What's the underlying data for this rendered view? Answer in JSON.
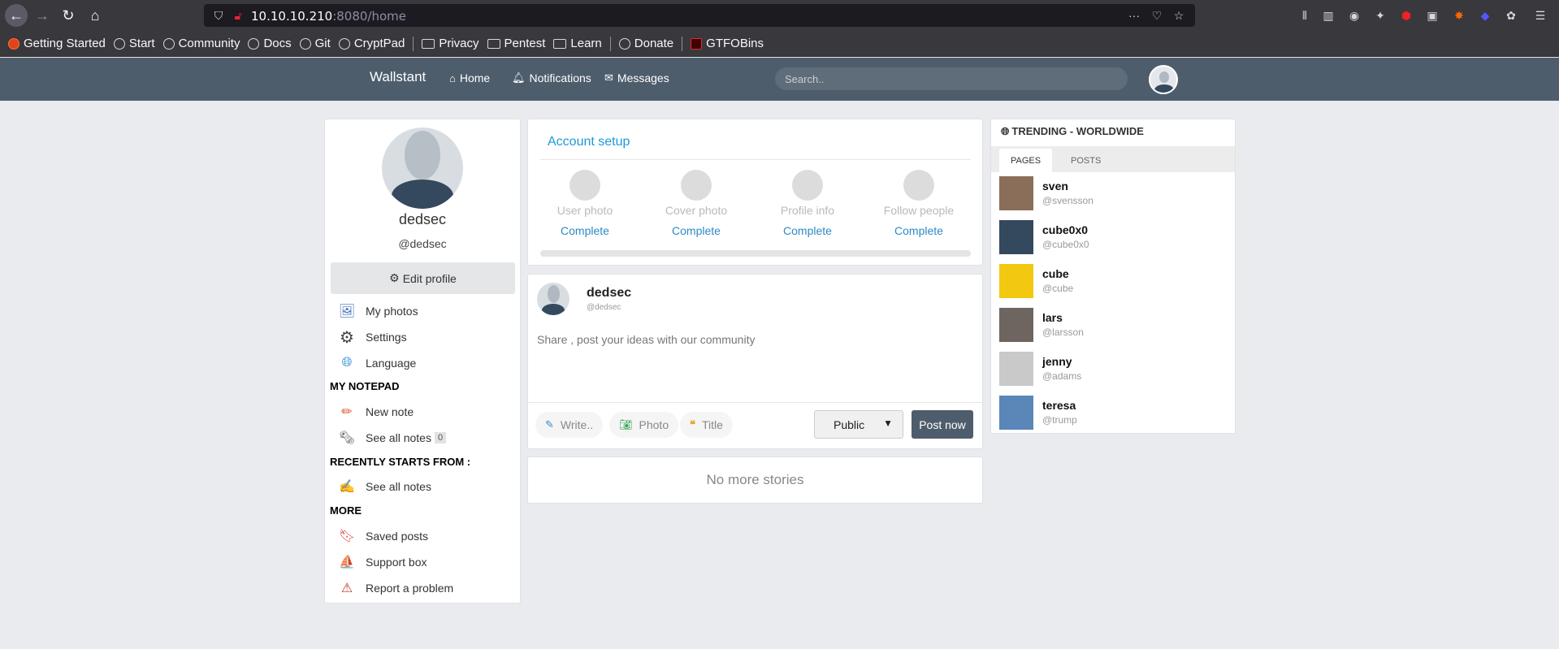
{
  "browser": {
    "url_host": "10.10.10.210",
    "url_rest": ":8080/home",
    "bookmarks": [
      {
        "label": "Getting Started",
        "icon": "firefox-icon"
      },
      {
        "label": "Start",
        "icon": "globe-icon"
      },
      {
        "label": "Community",
        "icon": "globe-icon"
      },
      {
        "label": "Docs",
        "icon": "globe-icon"
      },
      {
        "label": "Git",
        "icon": "globe-icon"
      },
      {
        "label": "CryptPad",
        "icon": "globe-icon"
      },
      {
        "label": "Privacy",
        "icon": "folder-icon"
      },
      {
        "label": "Pentest",
        "icon": "folder-icon"
      },
      {
        "label": "Learn",
        "icon": "folder-icon"
      },
      {
        "label": "Donate",
        "icon": "globe-icon"
      },
      {
        "label": "GTFOBins",
        "icon": "gtfobins-icon"
      }
    ]
  },
  "nav": {
    "brand": "Wallstant",
    "home": "Home",
    "notifications": "Notifications",
    "messages": "Messages",
    "search_placeholder": "Search.."
  },
  "profile": {
    "name": "dedsec",
    "handle": "@dedsec",
    "edit_profile": "Edit profile",
    "menu": {
      "my_photos": "My photos",
      "settings": "Settings",
      "language": "Language"
    },
    "notepad_header": "MY NOTEPAD",
    "new_note": "New note",
    "see_all_notes": "See all notes",
    "notes_count": "0",
    "recent_header": "RECENTLY STARTS FROM :",
    "recent_see_all": "See all notes",
    "more_header": "MORE",
    "saved_posts": "Saved posts",
    "support_box": "Support box",
    "report_problem": "Report a problem"
  },
  "account_setup": {
    "title": "Account setup",
    "steps": [
      {
        "label": "User photo",
        "status": "Complete"
      },
      {
        "label": "Cover photo",
        "status": "Complete"
      },
      {
        "label": "Profile info",
        "status": "Complete"
      },
      {
        "label": "Follow people",
        "status": "Complete"
      }
    ]
  },
  "composer": {
    "name": "dedsec",
    "handle": "@dedsec",
    "placeholder": "Share , post your ideas with our community",
    "write": "Write..",
    "photo": "Photo",
    "title": "Title",
    "visibility": "Public",
    "post_now": "Post now"
  },
  "stories": {
    "empty": "No more stories"
  },
  "trending": {
    "title": "TRENDING - WORLDWIDE",
    "tabs": {
      "pages": "PAGES",
      "posts": "POSTS"
    },
    "items": [
      {
        "name": "sven",
        "handle": "@svensson",
        "thumb_color": "#8a6e5a"
      },
      {
        "name": "cube0x0",
        "handle": "@cube0x0",
        "thumb_color": "#34495e"
      },
      {
        "name": "cube",
        "handle": "@cube",
        "thumb_color": "#f2c811"
      },
      {
        "name": "lars",
        "handle": "@larsson",
        "thumb_color": "#6e6460"
      },
      {
        "name": "jenny",
        "handle": "@adams",
        "thumb_color": "#c9c9c9"
      },
      {
        "name": "teresa",
        "handle": "@trump",
        "thumb_color": "#5a86b8"
      }
    ]
  }
}
